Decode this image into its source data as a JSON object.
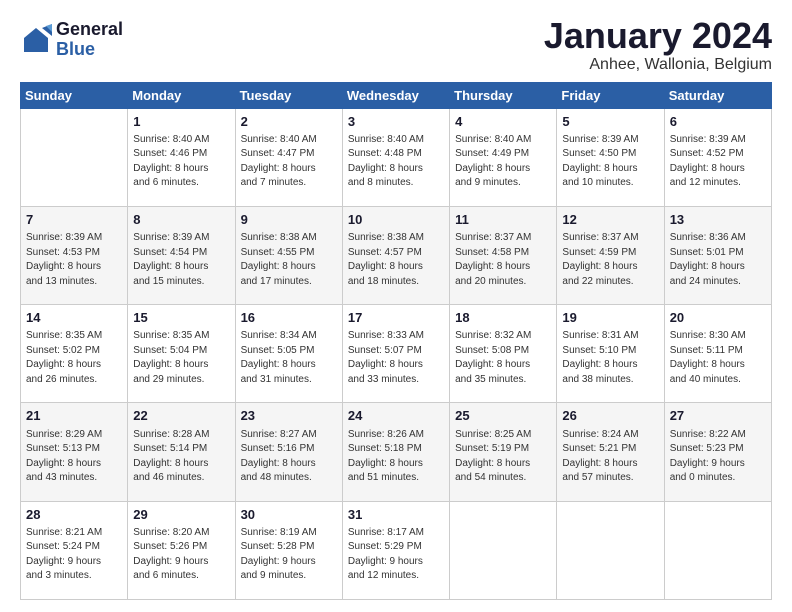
{
  "logo": {
    "general": "General",
    "blue": "Blue"
  },
  "title": "January 2024",
  "subtitle": "Anhee, Wallonia, Belgium",
  "weekdays": [
    "Sunday",
    "Monday",
    "Tuesday",
    "Wednesday",
    "Thursday",
    "Friday",
    "Saturday"
  ],
  "weeks": [
    [
      {
        "day": "",
        "info": ""
      },
      {
        "day": "1",
        "info": "Sunrise: 8:40 AM\nSunset: 4:46 PM\nDaylight: 8 hours\nand 6 minutes."
      },
      {
        "day": "2",
        "info": "Sunrise: 8:40 AM\nSunset: 4:47 PM\nDaylight: 8 hours\nand 7 minutes."
      },
      {
        "day": "3",
        "info": "Sunrise: 8:40 AM\nSunset: 4:48 PM\nDaylight: 8 hours\nand 8 minutes."
      },
      {
        "day": "4",
        "info": "Sunrise: 8:40 AM\nSunset: 4:49 PM\nDaylight: 8 hours\nand 9 minutes."
      },
      {
        "day": "5",
        "info": "Sunrise: 8:39 AM\nSunset: 4:50 PM\nDaylight: 8 hours\nand 10 minutes."
      },
      {
        "day": "6",
        "info": "Sunrise: 8:39 AM\nSunset: 4:52 PM\nDaylight: 8 hours\nand 12 minutes."
      }
    ],
    [
      {
        "day": "7",
        "info": "Sunrise: 8:39 AM\nSunset: 4:53 PM\nDaylight: 8 hours\nand 13 minutes."
      },
      {
        "day": "8",
        "info": "Sunrise: 8:39 AM\nSunset: 4:54 PM\nDaylight: 8 hours\nand 15 minutes."
      },
      {
        "day": "9",
        "info": "Sunrise: 8:38 AM\nSunset: 4:55 PM\nDaylight: 8 hours\nand 17 minutes."
      },
      {
        "day": "10",
        "info": "Sunrise: 8:38 AM\nSunset: 4:57 PM\nDaylight: 8 hours\nand 18 minutes."
      },
      {
        "day": "11",
        "info": "Sunrise: 8:37 AM\nSunset: 4:58 PM\nDaylight: 8 hours\nand 20 minutes."
      },
      {
        "day": "12",
        "info": "Sunrise: 8:37 AM\nSunset: 4:59 PM\nDaylight: 8 hours\nand 22 minutes."
      },
      {
        "day": "13",
        "info": "Sunrise: 8:36 AM\nSunset: 5:01 PM\nDaylight: 8 hours\nand 24 minutes."
      }
    ],
    [
      {
        "day": "14",
        "info": "Sunrise: 8:35 AM\nSunset: 5:02 PM\nDaylight: 8 hours\nand 26 minutes."
      },
      {
        "day": "15",
        "info": "Sunrise: 8:35 AM\nSunset: 5:04 PM\nDaylight: 8 hours\nand 29 minutes."
      },
      {
        "day": "16",
        "info": "Sunrise: 8:34 AM\nSunset: 5:05 PM\nDaylight: 8 hours\nand 31 minutes."
      },
      {
        "day": "17",
        "info": "Sunrise: 8:33 AM\nSunset: 5:07 PM\nDaylight: 8 hours\nand 33 minutes."
      },
      {
        "day": "18",
        "info": "Sunrise: 8:32 AM\nSunset: 5:08 PM\nDaylight: 8 hours\nand 35 minutes."
      },
      {
        "day": "19",
        "info": "Sunrise: 8:31 AM\nSunset: 5:10 PM\nDaylight: 8 hours\nand 38 minutes."
      },
      {
        "day": "20",
        "info": "Sunrise: 8:30 AM\nSunset: 5:11 PM\nDaylight: 8 hours\nand 40 minutes."
      }
    ],
    [
      {
        "day": "21",
        "info": "Sunrise: 8:29 AM\nSunset: 5:13 PM\nDaylight: 8 hours\nand 43 minutes."
      },
      {
        "day": "22",
        "info": "Sunrise: 8:28 AM\nSunset: 5:14 PM\nDaylight: 8 hours\nand 46 minutes."
      },
      {
        "day": "23",
        "info": "Sunrise: 8:27 AM\nSunset: 5:16 PM\nDaylight: 8 hours\nand 48 minutes."
      },
      {
        "day": "24",
        "info": "Sunrise: 8:26 AM\nSunset: 5:18 PM\nDaylight: 8 hours\nand 51 minutes."
      },
      {
        "day": "25",
        "info": "Sunrise: 8:25 AM\nSunset: 5:19 PM\nDaylight: 8 hours\nand 54 minutes."
      },
      {
        "day": "26",
        "info": "Sunrise: 8:24 AM\nSunset: 5:21 PM\nDaylight: 8 hours\nand 57 minutes."
      },
      {
        "day": "27",
        "info": "Sunrise: 8:22 AM\nSunset: 5:23 PM\nDaylight: 9 hours\nand 0 minutes."
      }
    ],
    [
      {
        "day": "28",
        "info": "Sunrise: 8:21 AM\nSunset: 5:24 PM\nDaylight: 9 hours\nand 3 minutes."
      },
      {
        "day": "29",
        "info": "Sunrise: 8:20 AM\nSunset: 5:26 PM\nDaylight: 9 hours\nand 6 minutes."
      },
      {
        "day": "30",
        "info": "Sunrise: 8:19 AM\nSunset: 5:28 PM\nDaylight: 9 hours\nand 9 minutes."
      },
      {
        "day": "31",
        "info": "Sunrise: 8:17 AM\nSunset: 5:29 PM\nDaylight: 9 hours\nand 12 minutes."
      },
      {
        "day": "",
        "info": ""
      },
      {
        "day": "",
        "info": ""
      },
      {
        "day": "",
        "info": ""
      }
    ]
  ]
}
